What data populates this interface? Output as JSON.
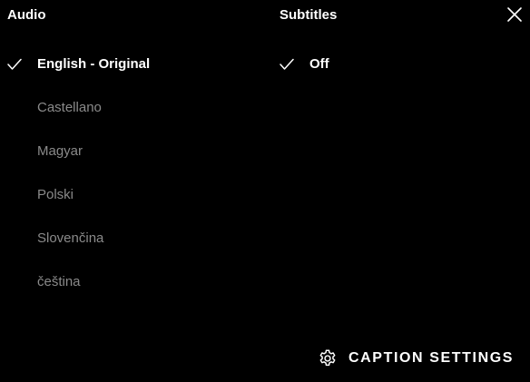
{
  "audio": {
    "header": "Audio",
    "options": [
      {
        "label": "English - Original",
        "selected": true
      },
      {
        "label": "Castellano",
        "selected": false
      },
      {
        "label": "Magyar",
        "selected": false
      },
      {
        "label": "Polski",
        "selected": false
      },
      {
        "label": "Slovenčina",
        "selected": false
      },
      {
        "label": "čeština",
        "selected": false
      }
    ]
  },
  "subtitles": {
    "header": "Subtitles",
    "options": [
      {
        "label": "Off",
        "selected": true
      }
    ]
  },
  "caption_settings": {
    "label": "CAPTION SETTINGS",
    "icon": "gear-icon"
  },
  "close": {
    "icon": "close-icon"
  },
  "colors": {
    "background": "#000000",
    "selected_text": "#ffffff",
    "unselected_text": "#8a8a8a"
  }
}
